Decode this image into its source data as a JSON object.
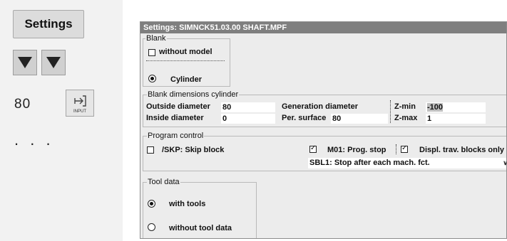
{
  "left_panel": {
    "settings_label": "Settings",
    "input_value": "80",
    "input_key_label": "INPUT",
    "more_label": "..."
  },
  "dialog": {
    "title": "Settings:  SIMNCK51.03.00   SHAFT.MPF",
    "blank": {
      "legend": "Blank",
      "without_model_label": "without model",
      "without_model_checked": false,
      "cylinder_label": "Cylinder",
      "cylinder_selected": true
    },
    "dims": {
      "legend": "Blank dimensions cylinder",
      "outside_diameter_label": "Outside diameter",
      "outside_diameter_value": "80",
      "inside_diameter_label": "Inside diameter",
      "inside_diameter_value": "0",
      "generation_diameter_label": "Generation diameter",
      "per_surface_label": "Per. surface",
      "per_surface_value": "80",
      "zmin_label": "Z-min",
      "zmin_value": "-100",
      "zmax_label": "Z-max",
      "zmax_value": "1"
    },
    "program": {
      "legend": "Program control",
      "skp_label": "/SKP: Skip block",
      "skp_checked": false,
      "m01_label": "M01: Prog. stop",
      "m01_checked": true,
      "displ_label": "Displ. trav. blocks only",
      "displ_checked": true,
      "sbl_value": "SBL1: Stop after each mach. fct."
    },
    "tool": {
      "legend": "Tool data",
      "with_tools_label": "with tools",
      "with_tools_selected": true,
      "without_tool_data_label": "without tool data",
      "without_tool_data_selected": false
    }
  }
}
